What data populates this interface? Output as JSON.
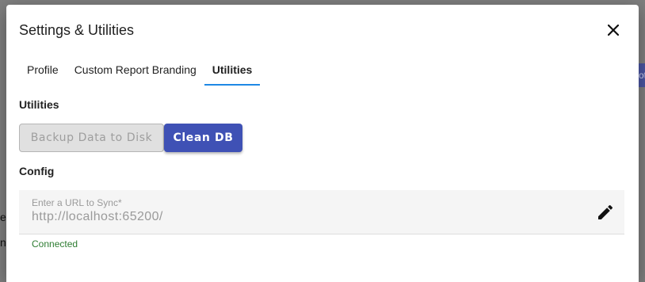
{
  "background": {
    "fragment_1": "e",
    "fragment_2": "n",
    "button_fragment": "ot"
  },
  "dialog": {
    "title": "Settings & Utilities",
    "close_icon": "close-icon"
  },
  "tabs": [
    {
      "label": "Profile",
      "active": false
    },
    {
      "label": "Custom Report Branding",
      "active": false
    },
    {
      "label": "Utilities",
      "active": true
    }
  ],
  "utilities": {
    "heading": "Utilities",
    "backup_label": "Backup Data to Disk",
    "backup_disabled": true,
    "clean_label": "Clean DB"
  },
  "config": {
    "heading": "Config",
    "url_label": "Enter a URL to Sync*",
    "url_value": "http://localhost:65200/",
    "edit_icon": "pencil-icon",
    "status": "Connected"
  },
  "colors": {
    "accent": "#3f51b5",
    "tab_indicator": "#1e88e5",
    "status_ok": "#2e7d32"
  }
}
